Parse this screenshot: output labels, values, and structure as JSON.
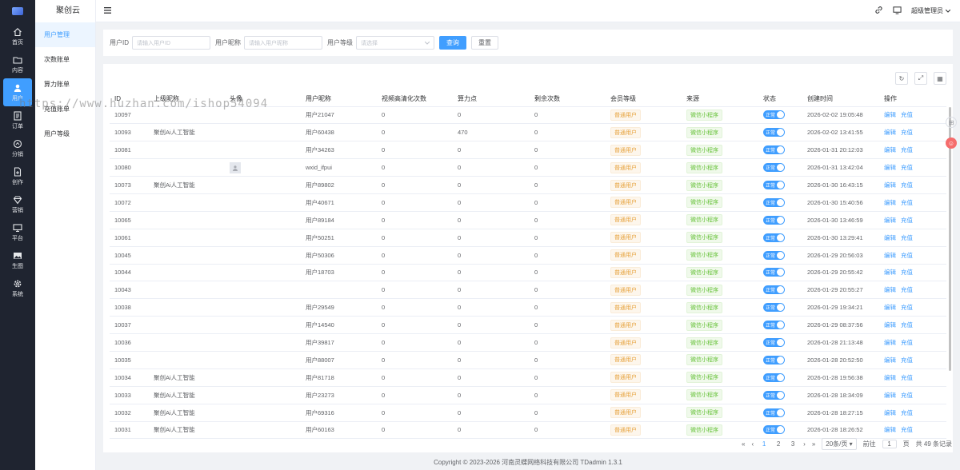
{
  "brand": {
    "name": "聚创云"
  },
  "leftnav": [
    {
      "label": "首页",
      "icon": "home-icon"
    },
    {
      "label": "内容",
      "icon": "folder-icon"
    },
    {
      "label": "用户",
      "icon": "user-icon"
    },
    {
      "label": "订单",
      "icon": "order-icon"
    },
    {
      "label": "分销",
      "icon": "share-icon"
    },
    {
      "label": "创作",
      "icon": "doc-icon"
    },
    {
      "label": "营销",
      "icon": "diamond-icon"
    },
    {
      "label": "平台",
      "icon": "monitor-icon"
    },
    {
      "label": "生图",
      "icon": "image-icon"
    },
    {
      "label": "系统",
      "icon": "gear-icon"
    }
  ],
  "subnav": [
    "用户管理",
    "次数账单",
    "算力账单",
    "充值账单",
    "用户等级"
  ],
  "header": {
    "user": "超级管理员"
  },
  "search": {
    "id_label": "用户ID",
    "id_placeholder": "请输入用户ID",
    "nick_label": "用户昵称",
    "nick_placeholder": "请输入用户昵称",
    "level_label": "用户等级",
    "level_placeholder": "请选择",
    "query": "查询",
    "reset": "重置"
  },
  "table": {
    "headers": [
      "ID",
      "上级昵称",
      "头像",
      "用户昵称",
      "视频高清化次数",
      "算力点",
      "剩余次数",
      "会员等级",
      "来源",
      "状态",
      "创建时间",
      "操作"
    ],
    "level_tag": "普通用户",
    "source_tag": "微信小程序",
    "switch_text": "正常",
    "edit": "编辑",
    "recharge": "充值",
    "rows": [
      {
        "id": "10097",
        "parent": "",
        "avatar": false,
        "nick": "用户21047",
        "video": "0",
        "power": "0",
        "remain": "0",
        "time": "2026-02-02 19:05:48"
      },
      {
        "id": "10093",
        "parent": "聚创Ai人工智能",
        "avatar": false,
        "nick": "用户60438",
        "video": "0",
        "power": "470",
        "remain": "0",
        "time": "2026-02-02 13:41:55"
      },
      {
        "id": "10081",
        "parent": "",
        "avatar": false,
        "nick": "用户34263",
        "video": "0",
        "power": "0",
        "remain": "0",
        "time": "2026-01-31 20:12:03"
      },
      {
        "id": "10080",
        "parent": "",
        "avatar": true,
        "nick": "wxid_ifpui",
        "video": "0",
        "power": "0",
        "remain": "0",
        "time": "2026-01-31 13:42:04"
      },
      {
        "id": "10073",
        "parent": "聚创Ai人工智能",
        "avatar": false,
        "nick": "用户89802",
        "video": "0",
        "power": "0",
        "remain": "0",
        "time": "2026-01-30 16:43:15"
      },
      {
        "id": "10072",
        "parent": "",
        "avatar": false,
        "nick": "用户40671",
        "video": "0",
        "power": "0",
        "remain": "0",
        "time": "2026-01-30 15:40:56"
      },
      {
        "id": "10065",
        "parent": "",
        "avatar": false,
        "nick": "用户89184",
        "video": "0",
        "power": "0",
        "remain": "0",
        "time": "2026-01-30 13:46:59"
      },
      {
        "id": "10061",
        "parent": "",
        "avatar": false,
        "nick": "用户50251",
        "video": "0",
        "power": "0",
        "remain": "0",
        "time": "2026-01-30 13:29:41"
      },
      {
        "id": "10045",
        "parent": "",
        "avatar": false,
        "nick": "用户50306",
        "video": "0",
        "power": "0",
        "remain": "0",
        "time": "2026-01-29 20:56:03"
      },
      {
        "id": "10044",
        "parent": "",
        "avatar": false,
        "nick": "用户18703",
        "video": "0",
        "power": "0",
        "remain": "0",
        "time": "2026-01-29 20:55:42"
      },
      {
        "id": "10043",
        "parent": "",
        "avatar": false,
        "nick": "",
        "video": "0",
        "power": "0",
        "remain": "0",
        "time": "2026-01-29 20:55:27"
      },
      {
        "id": "10038",
        "parent": "",
        "avatar": false,
        "nick": "用户29549",
        "video": "0",
        "power": "0",
        "remain": "0",
        "time": "2026-01-29 19:34:21"
      },
      {
        "id": "10037",
        "parent": "",
        "avatar": false,
        "nick": "用户14540",
        "video": "0",
        "power": "0",
        "remain": "0",
        "time": "2026-01-29 08:37:56"
      },
      {
        "id": "10036",
        "parent": "",
        "avatar": false,
        "nick": "用户39817",
        "video": "0",
        "power": "0",
        "remain": "0",
        "time": "2026-01-28 21:13:48"
      },
      {
        "id": "10035",
        "parent": "",
        "avatar": false,
        "nick": "用户88007",
        "video": "0",
        "power": "0",
        "remain": "0",
        "time": "2026-01-28 20:52:50"
      },
      {
        "id": "10034",
        "parent": "聚创Ai人工智能",
        "avatar": false,
        "nick": "用户81718",
        "video": "0",
        "power": "0",
        "remain": "0",
        "time": "2026-01-28 19:56:38"
      },
      {
        "id": "10033",
        "parent": "聚创Ai人工智能",
        "avatar": false,
        "nick": "用户23273",
        "video": "0",
        "power": "0",
        "remain": "0",
        "time": "2026-01-28 18:34:09"
      },
      {
        "id": "10032",
        "parent": "聚创Ai人工智能",
        "avatar": false,
        "nick": "用户69316",
        "video": "0",
        "power": "0",
        "remain": "0",
        "time": "2026-01-28 18:27:15"
      },
      {
        "id": "10031",
        "parent": "聚创Ai人工智能",
        "avatar": false,
        "nick": "用户60163",
        "video": "0",
        "power": "0",
        "remain": "0",
        "time": "2026-01-28 18:26:52"
      }
    ]
  },
  "pager": {
    "pages": [
      "1",
      "2",
      "3"
    ],
    "size": "20条/页",
    "goto_label": "前往",
    "goto_value": "1",
    "page_unit": "页",
    "total": "共 49 条记录"
  },
  "footer": "Copyright © 2023-2026 河南灵蝶网络科技有限公司  TDadmin 1.3.1",
  "watermark": "https://www.huzhan.com/ishop54094"
}
